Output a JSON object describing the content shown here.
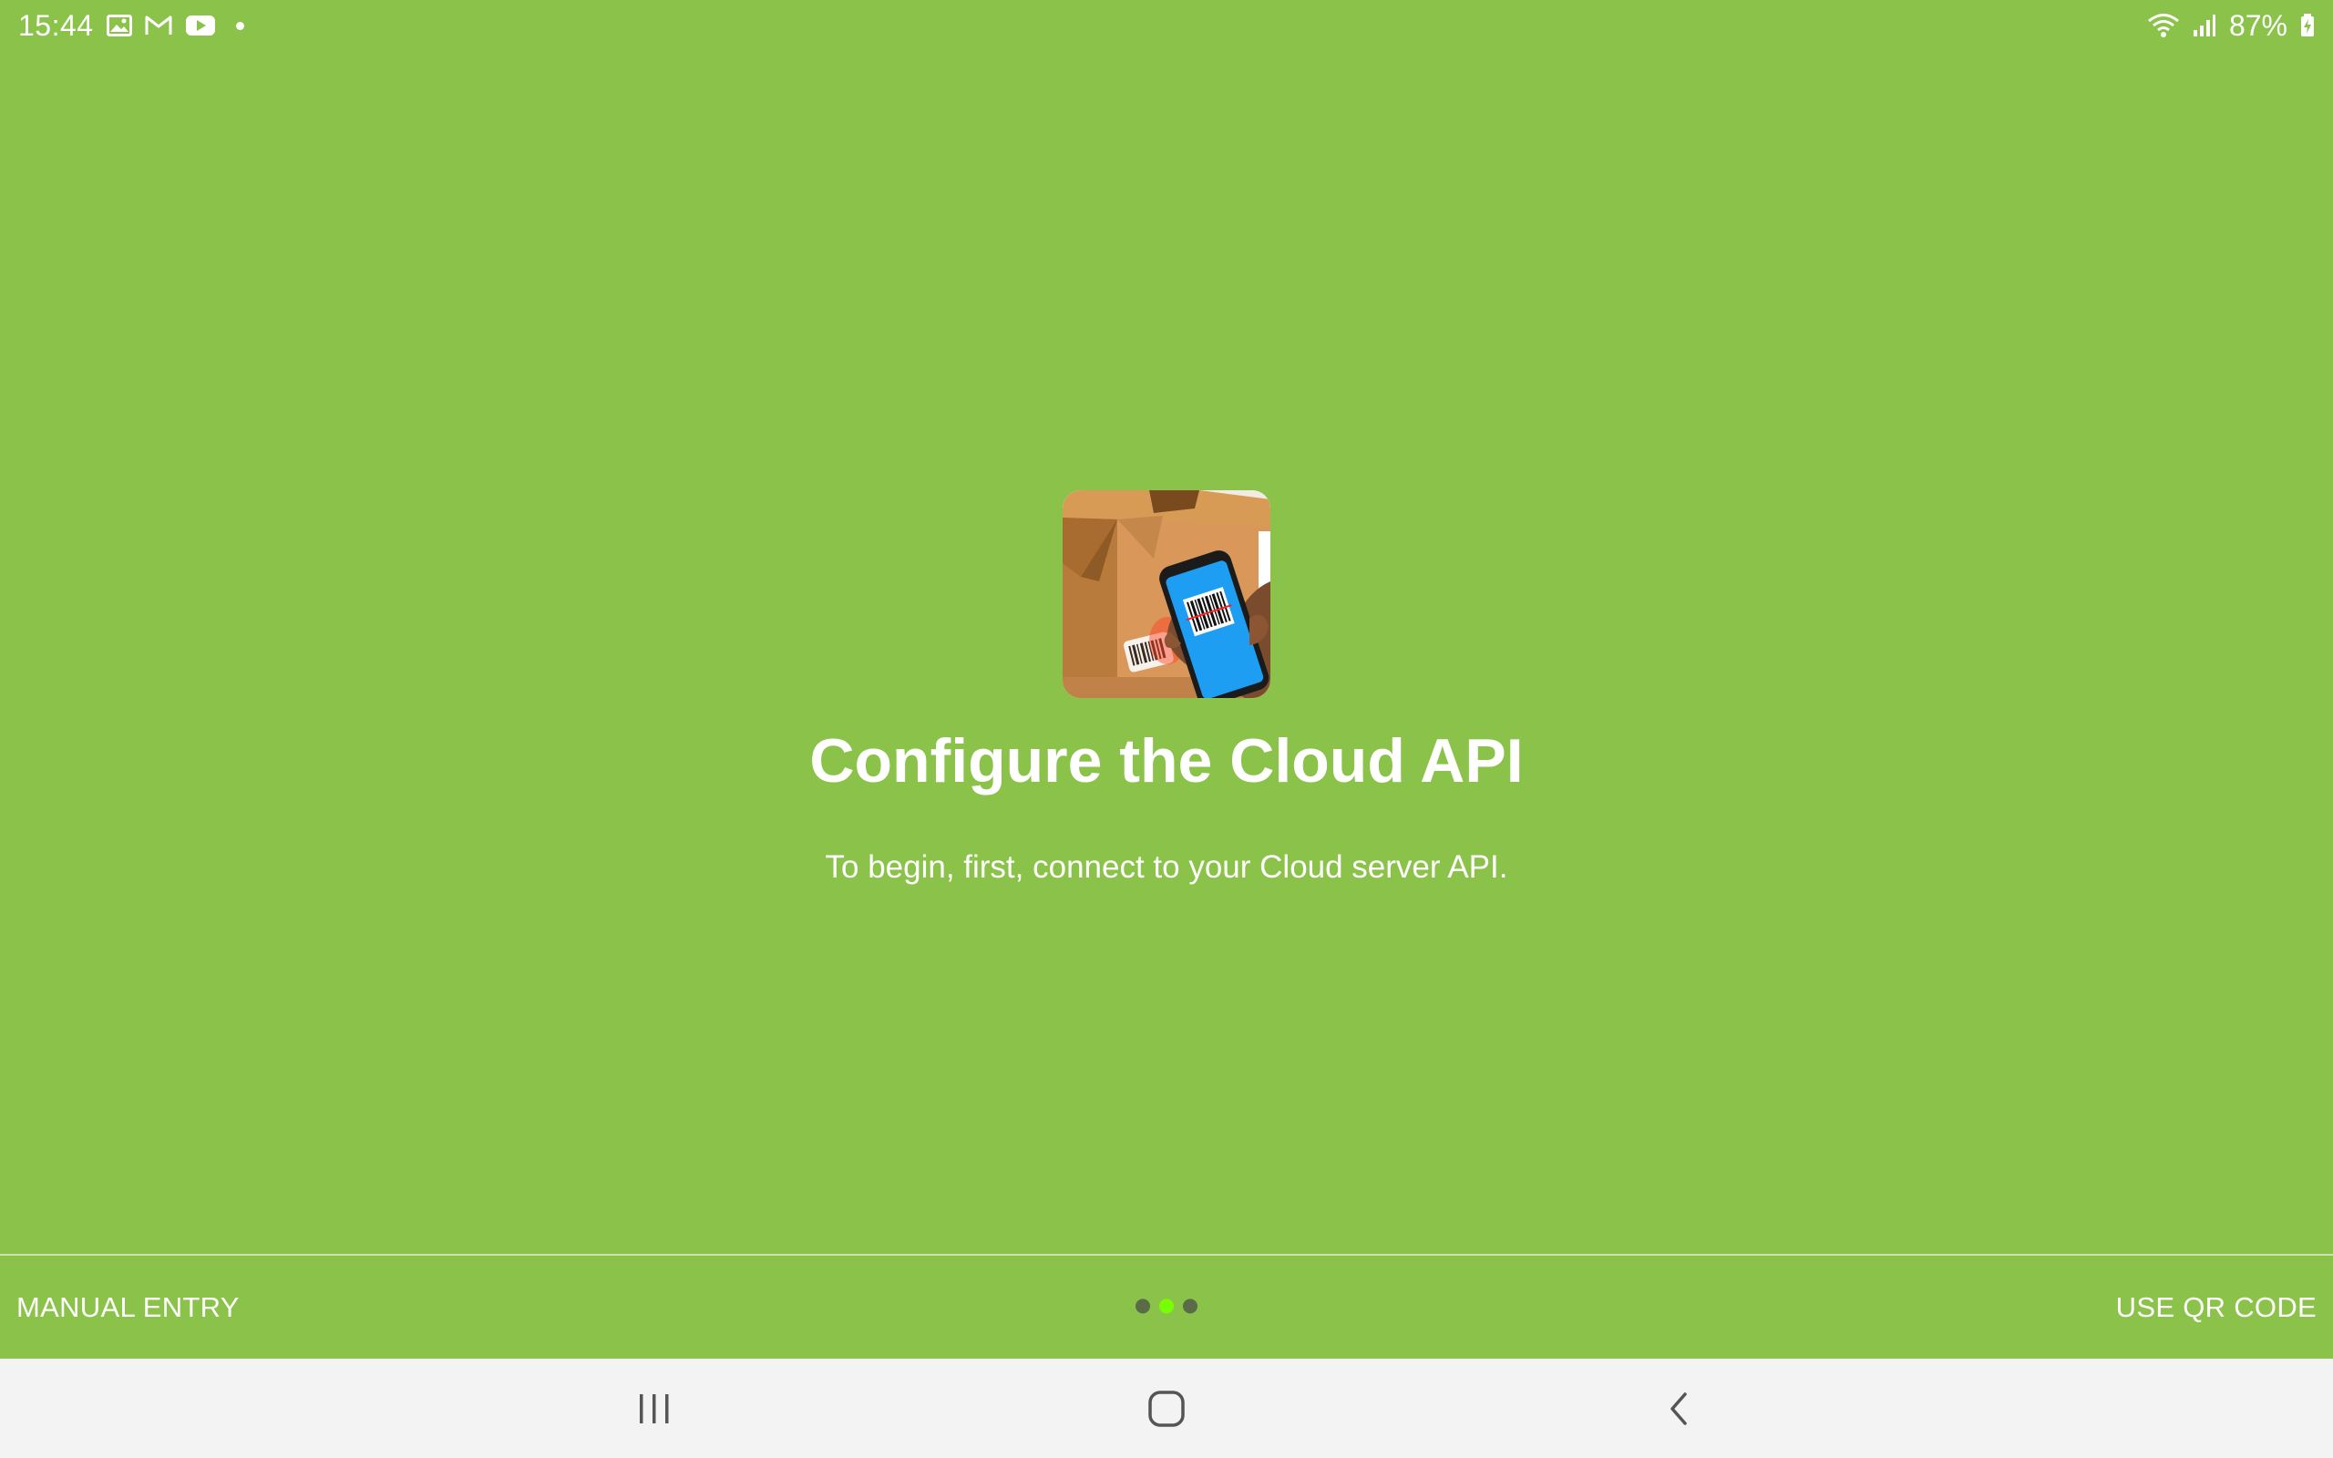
{
  "status_bar": {
    "time": "15:44",
    "left_icons": [
      "gallery-icon",
      "gmail-icon",
      "youtube-icon",
      "notification-dot-icon"
    ],
    "right_icons": [
      "wifi-icon",
      "signal-icon",
      "battery-charging-icon"
    ],
    "battery": "87%"
  },
  "main": {
    "app_icon": "package-barcode-scanner-icon",
    "title": "Configure the Cloud API",
    "subtitle": "To begin, first, connect to your Cloud server API."
  },
  "bottom_bar": {
    "left_button": "MANUAL ENTRY",
    "right_button": "USE QR CODE",
    "page_indicator": {
      "count": 3,
      "active_index": 1
    }
  },
  "nav_bar": {
    "buttons": [
      "recents-icon",
      "home-icon",
      "back-icon"
    ]
  },
  "colors": {
    "background": "#8bc34a",
    "active_dot": "#76ff03",
    "inactive_dot": "#5a6b47",
    "nav_bar": "#f3f3f3"
  }
}
